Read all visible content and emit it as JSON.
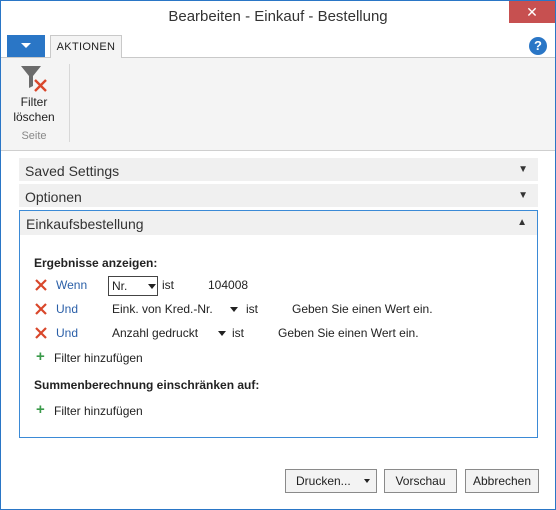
{
  "window": {
    "title": "Bearbeiten - Einkauf - Bestellung",
    "close_label": "✕"
  },
  "ribbon": {
    "tabs": [
      {
        "label": "AKTIONEN",
        "active": true
      }
    ],
    "items": [
      {
        "label_line1": "Filter",
        "label_line2": "löschen",
        "icon": "filter-clear-icon"
      }
    ],
    "group_label": "Seite",
    "help_label": "?"
  },
  "fasttabs": [
    {
      "title": "Saved Settings",
      "expanded": false
    },
    {
      "title": "Optionen",
      "expanded": false
    },
    {
      "title": "Einkaufsbestellung",
      "expanded": true
    }
  ],
  "results": {
    "heading": "Ergebnisse anzeigen:",
    "filters": [
      {
        "connector": "Wenn",
        "field": "Nr.",
        "op": "ist",
        "value": "104008"
      },
      {
        "connector": "Und",
        "field": "Eink. von Kred.-Nr.",
        "op": "ist",
        "value": "Geben Sie einen Wert ein."
      },
      {
        "connector": "Und",
        "field": "Anzahl gedruckt",
        "op": "ist",
        "value": "Geben Sie einen Wert ein."
      }
    ],
    "add_filter_label": "Filter hinzufügen"
  },
  "totals": {
    "heading": "Summenberechnung einschränken auf:",
    "add_filter_label": "Filter hinzufügen"
  },
  "buttons": {
    "print": "Drucken...",
    "preview": "Vorschau",
    "cancel": "Abbrechen"
  },
  "colors": {
    "accent": "#2a76c6",
    "remove_x": "#d9472b",
    "add_plus": "#3a9a4a",
    "close_button": "#c75050"
  }
}
